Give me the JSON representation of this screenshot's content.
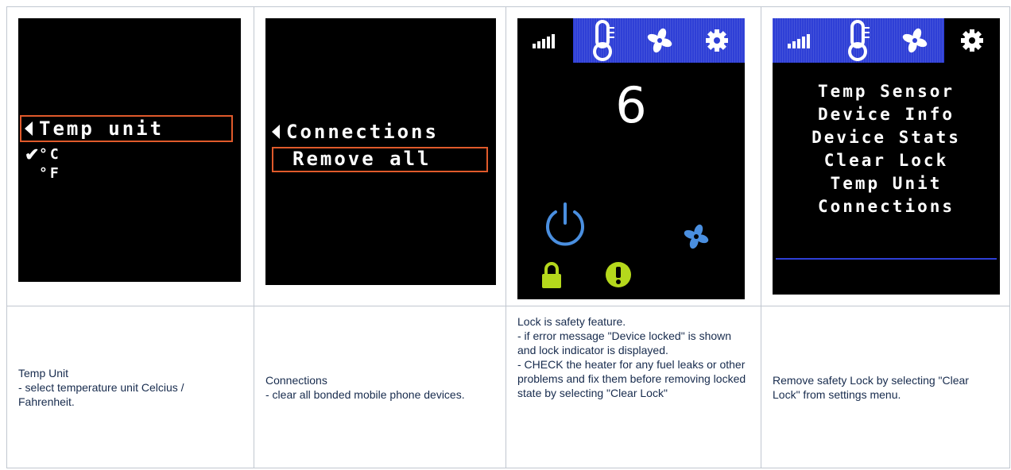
{
  "screens": {
    "temp_unit": {
      "title": "Temp unit",
      "options": [
        {
          "label": "°C",
          "checked": true
        },
        {
          "label": "°F",
          "checked": false
        }
      ]
    },
    "connections": {
      "title": "Connections",
      "selected_item": "Remove all"
    },
    "main": {
      "value": "6",
      "active_tab": "signal-icon"
    },
    "settings": {
      "active_tab": "gear-icon",
      "items": [
        "Temp Sensor",
        "Device Info",
        "Device Stats",
        "Clear Lock",
        "Temp Unit",
        "Connections"
      ]
    }
  },
  "descriptions": [
    "Temp Unit\n- select temperature unit Celcius / Fahrenheit.",
    "Connections\n- clear all bonded mobile phone devices.",
    "Lock is safety feature.\n- if error message \"Device locked\" is shown and lock indicator is displayed.\n- CHECK the heater for any fuel leaks or other problems and fix them before removing locked state by selecting \"Clear Lock\"",
    "Remove safety Lock by selecting \"Clear Lock\" from settings menu."
  ],
  "colors": {
    "selection": "#e05a2b",
    "tab_bar": "#2e3fd6",
    "power": "#4a8fe0",
    "warning": "#b5d81c"
  }
}
